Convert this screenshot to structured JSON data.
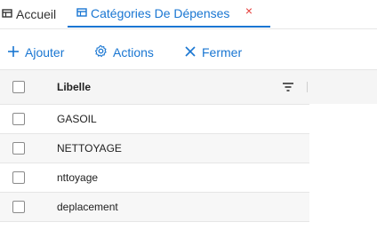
{
  "tabs": {
    "home_label": "Accueil",
    "active_label": "Catégories De Dépenses",
    "close_glyph": "×"
  },
  "toolbar": {
    "add_label": "Ajouter",
    "actions_label": "Actions",
    "close_label": "Fermer"
  },
  "grid": {
    "column_header": "Libelle",
    "rows": [
      {
        "libelle": "GASOIL"
      },
      {
        "libelle": "NETTOYAGE"
      },
      {
        "libelle": "nttoyage"
      },
      {
        "libelle": "deplacement"
      }
    ]
  },
  "colors": {
    "accent": "#1976d2",
    "close": "#e53935",
    "header_bg": "#f5f5f5",
    "alt_row_bg": "#f7f7f7"
  }
}
